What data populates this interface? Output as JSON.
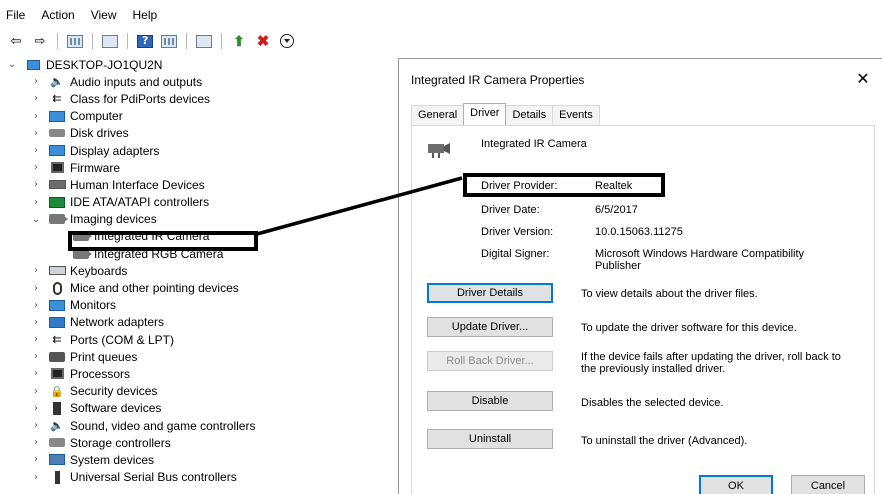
{
  "menubar": {
    "items": [
      "File",
      "Action",
      "View",
      "Help"
    ]
  },
  "tree": {
    "root": "DESKTOP-JO1QU2N",
    "items": [
      {
        "label": "Audio inputs and outputs",
        "icon": "speaker-icon"
      },
      {
        "label": "Class for PdiPorts devices",
        "icon": "port-icon"
      },
      {
        "label": "Computer",
        "icon": "computer-icon"
      },
      {
        "label": "Disk drives",
        "icon": "disk-drive-icon"
      },
      {
        "label": "Display adapters",
        "icon": "display-adapter-icon"
      },
      {
        "label": "Firmware",
        "icon": "firmware-icon"
      },
      {
        "label": "Human Interface Devices",
        "icon": "hid-icon"
      },
      {
        "label": "IDE ATA/ATAPI controllers",
        "icon": "ide-controller-icon"
      },
      {
        "label": "Imaging devices",
        "icon": "camera-icon"
      },
      {
        "label": "Keyboards",
        "icon": "keyboard-icon"
      },
      {
        "label": "Mice and other pointing devices",
        "icon": "mouse-icon"
      },
      {
        "label": "Monitors",
        "icon": "monitor-icon"
      },
      {
        "label": "Network adapters",
        "icon": "network-adapter-icon"
      },
      {
        "label": "Ports (COM & LPT)",
        "icon": "port-icon"
      },
      {
        "label": "Print queues",
        "icon": "printer-icon"
      },
      {
        "label": "Processors",
        "icon": "processor-icon"
      },
      {
        "label": "Security devices",
        "icon": "security-device-icon"
      },
      {
        "label": "Software devices",
        "icon": "software-device-icon"
      },
      {
        "label": "Sound, video and game controllers",
        "icon": "speaker-icon"
      },
      {
        "label": "Storage controllers",
        "icon": "storage-controller-icon"
      },
      {
        "label": "System devices",
        "icon": "system-device-icon"
      },
      {
        "label": "Universal Serial Bus controllers",
        "icon": "usb-icon"
      }
    ],
    "imaging_children": [
      "Integrated IR Camera",
      "Integrated RGB Camera"
    ]
  },
  "dialog": {
    "title": "Integrated IR Camera Properties",
    "close": "✕",
    "tabs": [
      "General",
      "Driver",
      "Details",
      "Events"
    ],
    "active_tab": "Driver",
    "device_name": "Integrated IR Camera",
    "info": {
      "provider_label": "Driver Provider:",
      "provider_value": "Realtek",
      "date_label": "Driver Date:",
      "date_value": "6/5/2017",
      "version_label": "Driver Version:",
      "version_value": "10.0.15063.11275",
      "signer_label": "Digital Signer:",
      "signer_value": "Microsoft Windows Hardware Compatibility Publisher"
    },
    "actions": {
      "details_label": "Driver Details",
      "details_desc": "To view details about the driver files.",
      "update_label": "Update Driver...",
      "update_desc": "To update the driver software for this device.",
      "rollback_label": "Roll Back Driver...",
      "rollback_desc": "If the device fails after updating the driver, roll back to the previously installed driver.",
      "disable_label": "Disable",
      "disable_desc": "Disables the selected device.",
      "uninstall_label": "Uninstall",
      "uninstall_desc": "To uninstall the driver (Advanced)."
    },
    "footer": {
      "ok": "OK",
      "cancel": "Cancel"
    }
  }
}
